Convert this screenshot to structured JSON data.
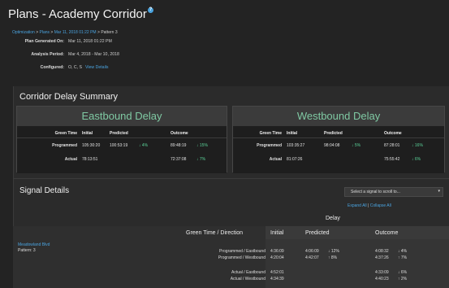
{
  "header": {
    "title": "Plans - Academy Corridor",
    "help_glyph": "?"
  },
  "breadcrumb": {
    "items": [
      "Optimization",
      "Plans",
      "Mar 11, 2018 01:22 PM"
    ],
    "separator": ">",
    "current": "Pattern 3"
  },
  "meta": {
    "plan_generated_label": "Plan Generated On:",
    "plan_generated_value": "Mar 11, 2018 01:22 PM",
    "analysis_period_label": "Analysis Period:",
    "analysis_period_value": "Mar 4, 2018 - Mar 10, 2018",
    "configured_label": "Configured:",
    "configured_value": "O, C, S",
    "view_details_link": "View Details"
  },
  "corridor": {
    "title": "Corridor Delay Summary",
    "eastbound": {
      "title": "Eastbound Delay",
      "headers": [
        "Green Time",
        "Initial",
        "Predicted",
        "Outcome"
      ],
      "rows": [
        {
          "label": "Programmed",
          "initial": "105:30:20",
          "predicted": "100:53:19",
          "predicted_change": "4%",
          "predicted_arrow": "↓",
          "outcome": "89:48:19",
          "outcome_change": "15%",
          "outcome_arrow": "↓"
        },
        {
          "label": "Actual",
          "initial": "78:13:51",
          "predicted": "",
          "predicted_change": "",
          "predicted_arrow": "",
          "outcome": "72:37:08",
          "outcome_change": "7%",
          "outcome_arrow": "↓"
        }
      ]
    },
    "westbound": {
      "title": "Westbound Delay",
      "headers": [
        "Green Time",
        "Initial",
        "Predicted",
        "Outcome"
      ],
      "rows": [
        {
          "label": "Programmed",
          "initial": "103:35:27",
          "predicted": "98:04:08",
          "predicted_change": "5%",
          "predicted_arrow": "↓",
          "outcome": "87:28:01",
          "outcome_change": "16%",
          "outcome_arrow": "↓"
        },
        {
          "label": "Actual",
          "initial": "81:07:26",
          "predicted": "",
          "predicted_change": "",
          "predicted_arrow": "",
          "outcome": "75:55:42",
          "outcome_change": "6%",
          "outcome_arrow": "↓"
        }
      ]
    }
  },
  "signals": {
    "title": "Signal Details",
    "select_placeholder": "Select a signal to scroll to...",
    "expand_all": "Expand All",
    "collapse_all": "Collapse All",
    "delay_group_label": "Delay",
    "columns": [
      "Green Time / Direction",
      "Initial",
      "Predicted",
      "Outcome"
    ],
    "signal_name": "Meadowland Blvd",
    "signal_pattern": "Pattern: 3",
    "rows": [
      {
        "label": "Programmed / Eastbound",
        "initial": "4:36:09",
        "predicted": "4:06:09",
        "predicted_change": "12%",
        "predicted_arrow": "↓",
        "predicted_dir": "down",
        "outcome": "4:08:32",
        "outcome_change": "4%",
        "outcome_arrow": "↓",
        "outcome_dir": "down"
      },
      {
        "label": "Programmed / Westbound",
        "initial": "4:20:04",
        "predicted": "4:42:07",
        "predicted_change": "8%",
        "predicted_arrow": "↑",
        "predicted_dir": "up",
        "outcome": "4:37:26",
        "outcome_change": "7%",
        "outcome_arrow": "↑",
        "outcome_dir": "up"
      },
      {
        "label": "Actual / Eastbound",
        "initial": "4:52:01",
        "predicted": "",
        "predicted_change": "",
        "predicted_arrow": "",
        "predicted_dir": "",
        "outcome": "4:33:09",
        "outcome_change": "6%",
        "outcome_arrow": "↓",
        "outcome_dir": "down"
      },
      {
        "label": "Actual / Westbound",
        "initial": "4:34:39",
        "predicted": "",
        "predicted_change": "",
        "predicted_arrow": "",
        "predicted_dir": "",
        "outcome": "4:40:23",
        "outcome_change": "2%",
        "outcome_arrow": "↑",
        "outcome_dir": "up"
      }
    ]
  },
  "colors": {
    "background": "#232323",
    "link": "#4aa3df",
    "delay_title": "#7fc9a3",
    "decrease": "#5bd49a",
    "increase": "#e0524d"
  }
}
